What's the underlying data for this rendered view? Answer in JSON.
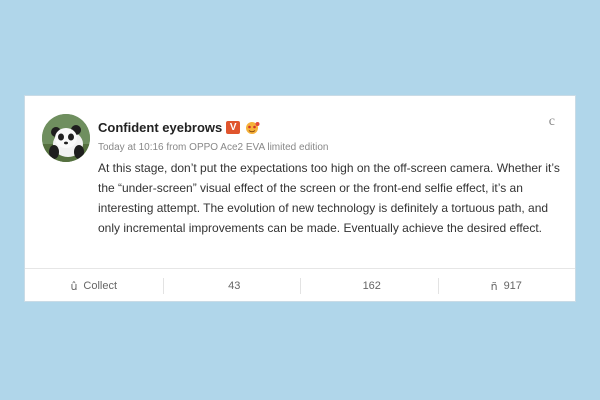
{
  "post": {
    "username": "Confident eyebrows",
    "vip_badge": "V",
    "meta": "Today at 10:16 from OPPO Ace2 EVA limited edition",
    "more_icon": "c",
    "text": "At this stage, don’t put the expectations too high on the off-screen camera. Whether it’s the “under-screen” visual effect of the screen or the front-end selfie effect, it’s an interesting attempt. The evolution of new technology is definitely a tortuous path, and only incremental improvements can be made. Eventually achieve the desired effect."
  },
  "actions": {
    "collect": {
      "icon": "û",
      "label": "Collect"
    },
    "repost": {
      "icon": "",
      "label": "43"
    },
    "comment": {
      "icon": "",
      "label": "162"
    },
    "like": {
      "icon": "ñ",
      "label": "917"
    }
  },
  "colors": {
    "background": "#b0d6ea",
    "card": "#ffffff",
    "vip_badge": "#e0552d"
  }
}
